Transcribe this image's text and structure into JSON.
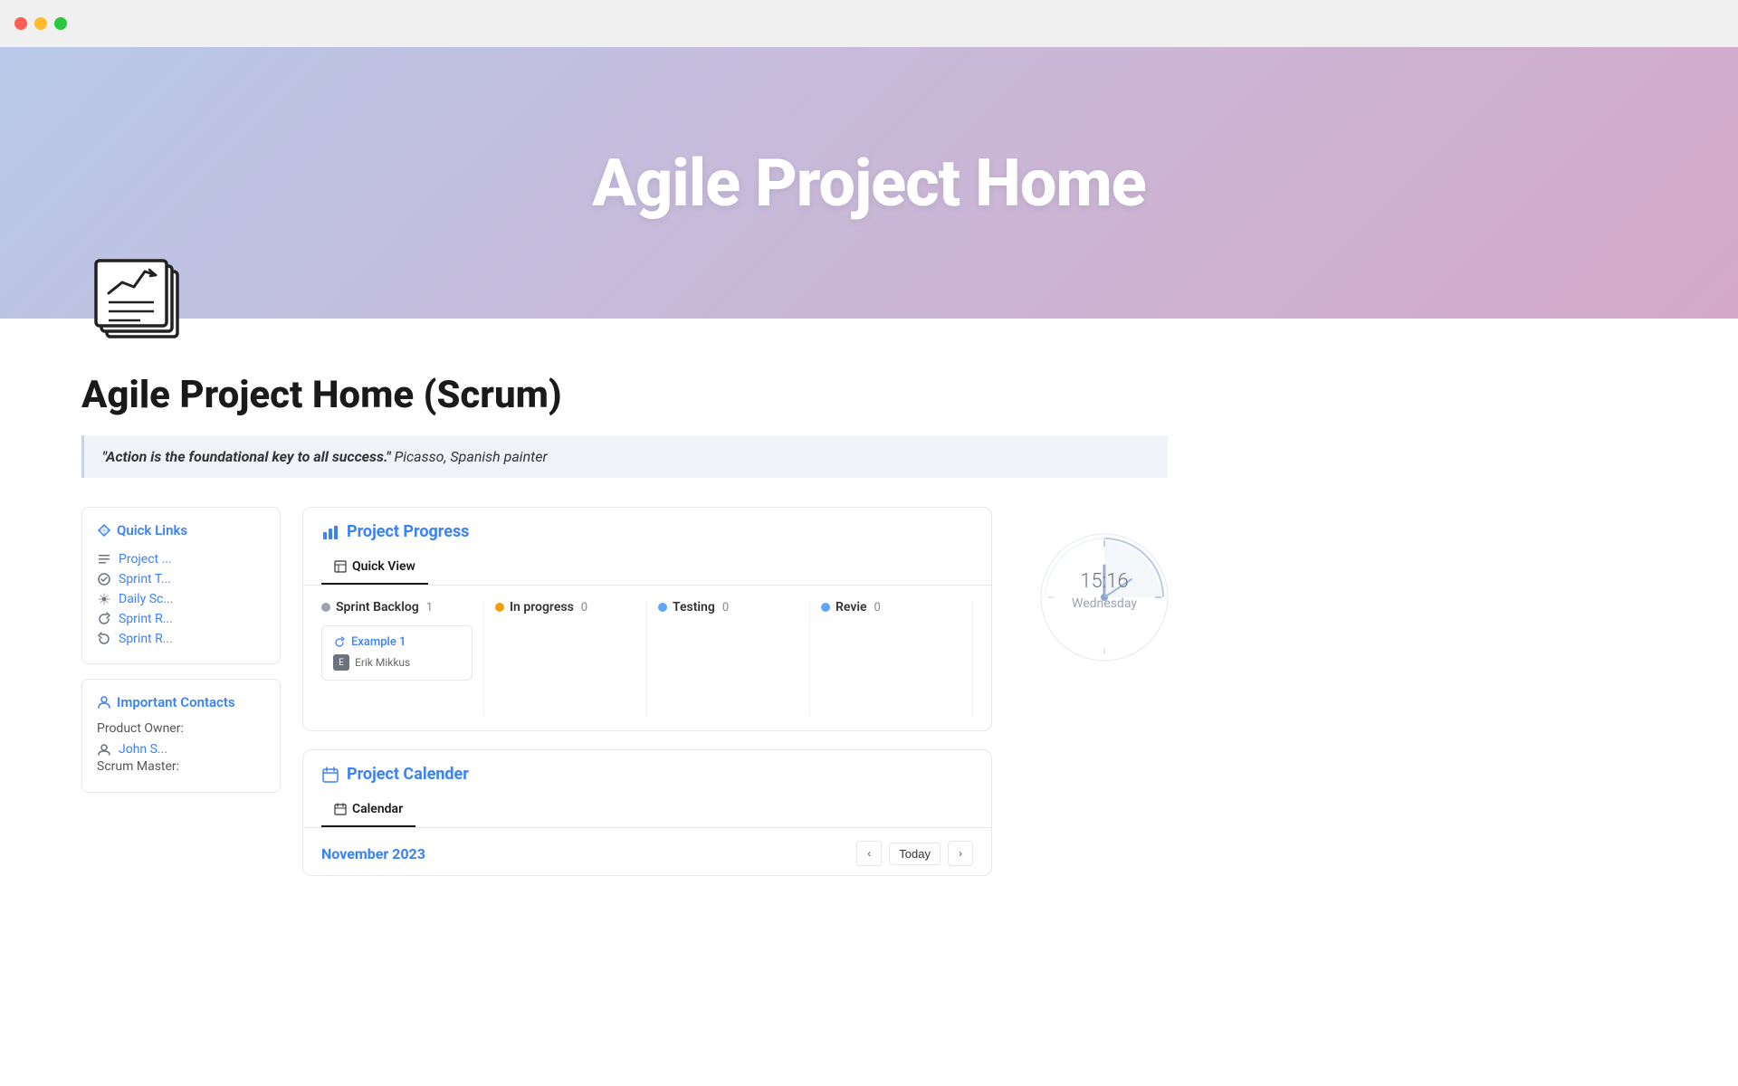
{
  "titlebar": {
    "btn_red": "close",
    "btn_yellow": "minimize",
    "btn_green": "maximize"
  },
  "hero": {
    "title": "Agile Project Home"
  },
  "page": {
    "heading": "Agile Project Home (Scrum)",
    "quote_text": "\"Action is the foundational key to all success.\"",
    "quote_author": " Picasso, Spanish painter"
  },
  "sidebar": {
    "quick_links_title": "Quick Links",
    "links": [
      {
        "icon": "list-icon",
        "label": "Project ..."
      },
      {
        "icon": "check-circle-icon",
        "label": "Sprint T..."
      },
      {
        "icon": "sparkle-icon",
        "label": "Daily Sc..."
      },
      {
        "icon": "refresh-icon",
        "label": "Sprint R..."
      },
      {
        "icon": "refresh-icon",
        "label": "Sprint R..."
      }
    ],
    "contacts_title": "Important Contacts",
    "contacts": [
      {
        "role": "Product Owner:",
        "name": "John S..."
      },
      {
        "role": "Scrum Master:",
        "name": ""
      }
    ]
  },
  "project_progress": {
    "section_title": "Project Progress",
    "tab_label": "Quick View",
    "columns": [
      {
        "name": "Sprint Backlog",
        "color": "#9ca3af",
        "count": 1
      },
      {
        "name": "In progress",
        "color": "#f59e0b",
        "count": 0
      },
      {
        "name": "Testing",
        "color": "#60a5fa",
        "count": 0
      },
      {
        "name": "Revie",
        "color": "#60a5fa",
        "count": 0
      }
    ],
    "tasks": [
      {
        "name": "Example 1",
        "assignee": "Erik Mikkus",
        "column": 0
      }
    ]
  },
  "project_calendar": {
    "section_title": "Project Calender",
    "tab_label": "Calendar",
    "month": "November 2023",
    "today_label": "Today"
  },
  "clock": {
    "time": "15:16",
    "day": "Wednesday"
  }
}
